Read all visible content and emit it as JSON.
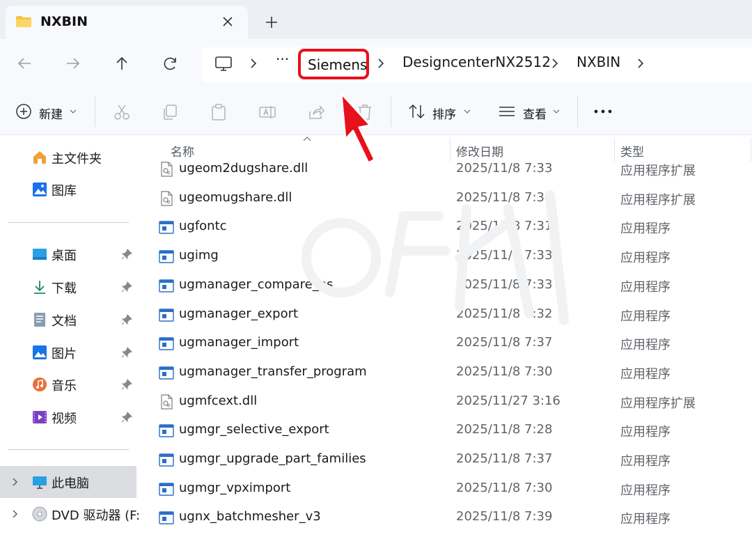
{
  "tab": {
    "title": "NXBIN",
    "close_icon": "close-icon",
    "new_tab_icon": "plus-icon"
  },
  "nav": {
    "back_icon": "arrow-left-icon",
    "forward_icon": "arrow-right-icon",
    "up_icon": "arrow-up-icon",
    "refresh_icon": "refresh-icon"
  },
  "address": {
    "more": "···",
    "crumbs": [
      "Siemens",
      "DesigncenterNX2512",
      "NXBIN"
    ]
  },
  "toolbar": {
    "new_label": "新建",
    "sort_label": "排序",
    "view_label": "查看",
    "more_label": "···"
  },
  "sidebar": {
    "home": "主文件夹",
    "gallery": "图库",
    "quick": [
      {
        "label": "桌面"
      },
      {
        "label": "下载"
      },
      {
        "label": "文档"
      },
      {
        "label": "图片"
      },
      {
        "label": "音乐"
      },
      {
        "label": "视频"
      }
    ],
    "this_pc": "此电脑",
    "dvd": "DVD 驱动器 (F:"
  },
  "columns": {
    "name": "名称",
    "date": "修改日期",
    "type": "类型"
  },
  "files": [
    {
      "name": "ugeom2dugshare.dll",
      "date": "2025/11/8 7:33",
      "type": "应用程序扩展",
      "kind": "dll"
    },
    {
      "name": "ugeomugshare.dll",
      "date": "2025/11/8 7:38",
      "type": "应用程序扩展",
      "kind": "dll"
    },
    {
      "name": "ugfontc",
      "date": "2025/11/8 7:31",
      "type": "应用程序",
      "kind": "exe"
    },
    {
      "name": "ugimg",
      "date": "2025/11/8 7:33",
      "type": "应用程序",
      "kind": "exe"
    },
    {
      "name": "ugmanager_compare_ps",
      "date": "2025/11/8 7:33",
      "type": "应用程序",
      "kind": "exe"
    },
    {
      "name": "ugmanager_export",
      "date": "2025/11/8 7:32",
      "type": "应用程序",
      "kind": "exe"
    },
    {
      "name": "ugmanager_import",
      "date": "2025/11/8 7:37",
      "type": "应用程序",
      "kind": "exe"
    },
    {
      "name": "ugmanager_transfer_program",
      "date": "2025/11/8 7:30",
      "type": "应用程序",
      "kind": "exe"
    },
    {
      "name": "ugmfcext.dll",
      "date": "2025/11/27 3:16",
      "type": "应用程序扩展",
      "kind": "dll"
    },
    {
      "name": "ugmgr_selective_export",
      "date": "2025/11/8 7:28",
      "type": "应用程序",
      "kind": "exe"
    },
    {
      "name": "ugmgr_upgrade_part_families",
      "date": "2025/11/8 7:37",
      "type": "应用程序",
      "kind": "exe"
    },
    {
      "name": "ugmgr_vpximport",
      "date": "2025/11/8 7:30",
      "type": "应用程序",
      "kind": "exe"
    },
    {
      "name": "ugnx_batchmesher_v3",
      "date": "2025/11/8 7:39",
      "type": "应用程序",
      "kind": "exe"
    }
  ],
  "colors": {
    "highlight": "#e8101a",
    "accent": "#0067c0"
  }
}
